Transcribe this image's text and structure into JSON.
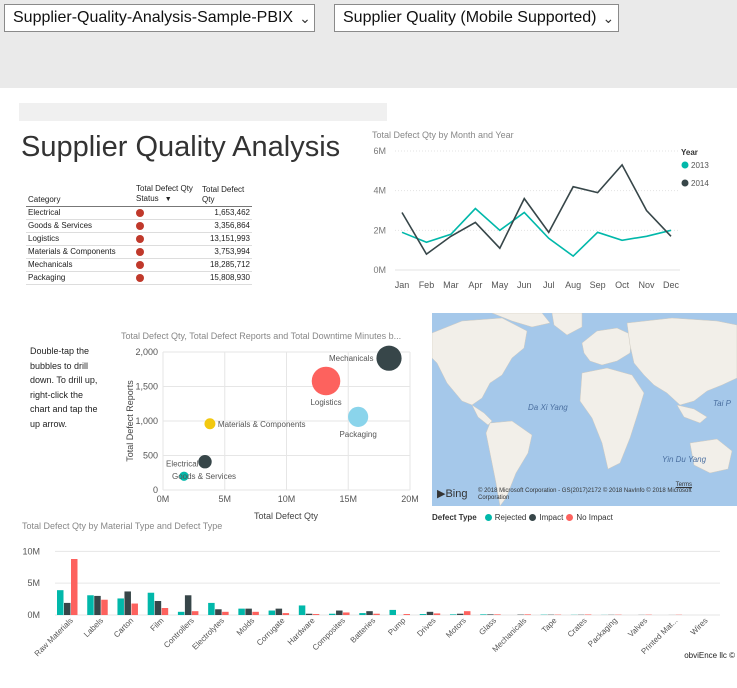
{
  "header": {
    "report_dropdown": "Supplier-Quality-Analysis-Sample-PBIX",
    "page_dropdown": "Supplier Quality (Mobile Supported)"
  },
  "report": {
    "title": "Supplier Quality Analysis",
    "hint": "Double-tap the bubbles to drill down. To drill up, right-click the chart and tap the up arrow.",
    "footer": "obviEnce llc ©"
  },
  "category_table": {
    "headers": [
      "Category",
      "Total Defect Qty Status",
      "Total Defect Qty"
    ],
    "rows": [
      {
        "category": "Electrical",
        "qty": "1,653,462"
      },
      {
        "category": "Goods & Services",
        "qty": "3,356,864"
      },
      {
        "category": "Logistics",
        "qty": "13,151,993"
      },
      {
        "category": "Materials & Components",
        "qty": "3,753,994"
      },
      {
        "category": "Mechanicals",
        "qty": "18,285,712"
      },
      {
        "category": "Packaging",
        "qty": "15,808,930"
      }
    ],
    "status_color": "#c0392b"
  },
  "map": {
    "labels": [
      "Da Xi Yang",
      "Yin Du Yang",
      "Tai P"
    ],
    "logo": "Bing",
    "copyright": "© 2018 Microsoft Corporation - GS(2017)2172 © 2018 NavInfo © 2018 Microsoft Corporation",
    "terms": "Terms",
    "legend_title": "Defect Type",
    "legend": [
      {
        "name": "Rejected",
        "color": "#01b8aa"
      },
      {
        "name": "Impact",
        "color": "#374649"
      },
      {
        "name": "No Impact",
        "color": "#fd625e"
      }
    ]
  },
  "chart_data": [
    {
      "type": "line",
      "title": "Total Defect Qty by Month and Year",
      "legend_title": "Year",
      "legend_position": "right",
      "categories": [
        "Jan",
        "Feb",
        "Mar",
        "Apr",
        "May",
        "Jun",
        "Jul",
        "Aug",
        "Sep",
        "Oct",
        "Nov",
        "Dec"
      ],
      "y_ticks": [
        "0M",
        "2M",
        "4M",
        "6M"
      ],
      "ylim": [
        0,
        6000000
      ],
      "grid": true,
      "series": [
        {
          "name": "2013",
          "color": "#01b8aa",
          "values": [
            1900000,
            1400000,
            1800000,
            3100000,
            2000000,
            2900000,
            1600000,
            700000,
            1900000,
            1500000,
            1700000,
            2000000
          ]
        },
        {
          "name": "2014",
          "color": "#374649",
          "values": [
            2900000,
            800000,
            1700000,
            2400000,
            1100000,
            3600000,
            1900000,
            4200000,
            3900000,
            5300000,
            3000000,
            1700000
          ]
        }
      ]
    },
    {
      "type": "scatter",
      "title": "Total Defect Qty, Total Defect Reports and Total Downtime Minutes b...",
      "xlabel": "Total Defect Qty",
      "ylabel": "Total Defect Reports",
      "x_ticks": [
        "0M",
        "5M",
        "10M",
        "15M",
        "20M"
      ],
      "y_ticks": [
        "0",
        "500",
        "1,000",
        "1,500",
        "2,000"
      ],
      "xlim": [
        0,
        20000000
      ],
      "ylim": [
        0,
        2000
      ],
      "grid": true,
      "points": [
        {
          "label": "Mechanicals",
          "x": 18300000,
          "y": 1910,
          "size": 3,
          "color": "#374649"
        },
        {
          "label": "Logistics",
          "x": 13200000,
          "y": 1580,
          "size": 3.4,
          "color": "#fd625e"
        },
        {
          "label": "Packaging",
          "x": 15800000,
          "y": 1060,
          "size": 2.4,
          "color": "#8ad4eb"
        },
        {
          "label": "Materials & Components",
          "x": 3800000,
          "y": 960,
          "size": 1.3,
          "color": "#f2c80f"
        },
        {
          "label": "Electrical",
          "x": 3400000,
          "y": 410,
          "size": 1.6,
          "color": "#374649"
        },
        {
          "label": "Goods & Services",
          "x": 1700000,
          "y": 200,
          "size": 1.1,
          "color": "#01b8aa"
        }
      ]
    },
    {
      "type": "bar",
      "title": "Total Defect Qty by Material Type and Defect Type",
      "categories": [
        "Raw Materials",
        "Labels",
        "Carton",
        "Film",
        "Controllers",
        "Electrolytes",
        "Molds",
        "Corrugate",
        "Hardware",
        "Composites",
        "Batteries",
        "Pump",
        "Drives",
        "Motors",
        "Glass",
        "Mechanicals",
        "Tape",
        "Crates",
        "Packaging",
        "Valves",
        "Printed Mat...",
        "Wires"
      ],
      "y_ticks": [
        "0M",
        "5M",
        "10M"
      ],
      "ylim": [
        0,
        11000000
      ],
      "grid": true,
      "series": [
        {
          "name": "Rejected",
          "color": "#01b8aa",
          "values": [
            3900000,
            3100000,
            2600000,
            3500000,
            500000,
            1900000,
            1000000,
            700000,
            1500000,
            200000,
            300000,
            800000,
            150000,
            100000,
            100000,
            0,
            50000,
            30000,
            20000,
            0,
            0,
            0
          ]
        },
        {
          "name": "Impact",
          "color": "#374649",
          "values": [
            1900000,
            3000000,
            3700000,
            2200000,
            3100000,
            900000,
            1000000,
            1000000,
            200000,
            700000,
            600000,
            0,
            500000,
            200000,
            100000,
            60000,
            50000,
            40000,
            30000,
            20000,
            10000,
            0
          ]
        },
        {
          "name": "No Impact",
          "color": "#fd625e",
          "values": [
            8800000,
            2400000,
            1800000,
            1100000,
            600000,
            500000,
            500000,
            300000,
            150000,
            400000,
            200000,
            150000,
            250000,
            600000,
            100000,
            100000,
            60000,
            80000,
            50000,
            50000,
            40000,
            0
          ]
        }
      ]
    }
  ]
}
